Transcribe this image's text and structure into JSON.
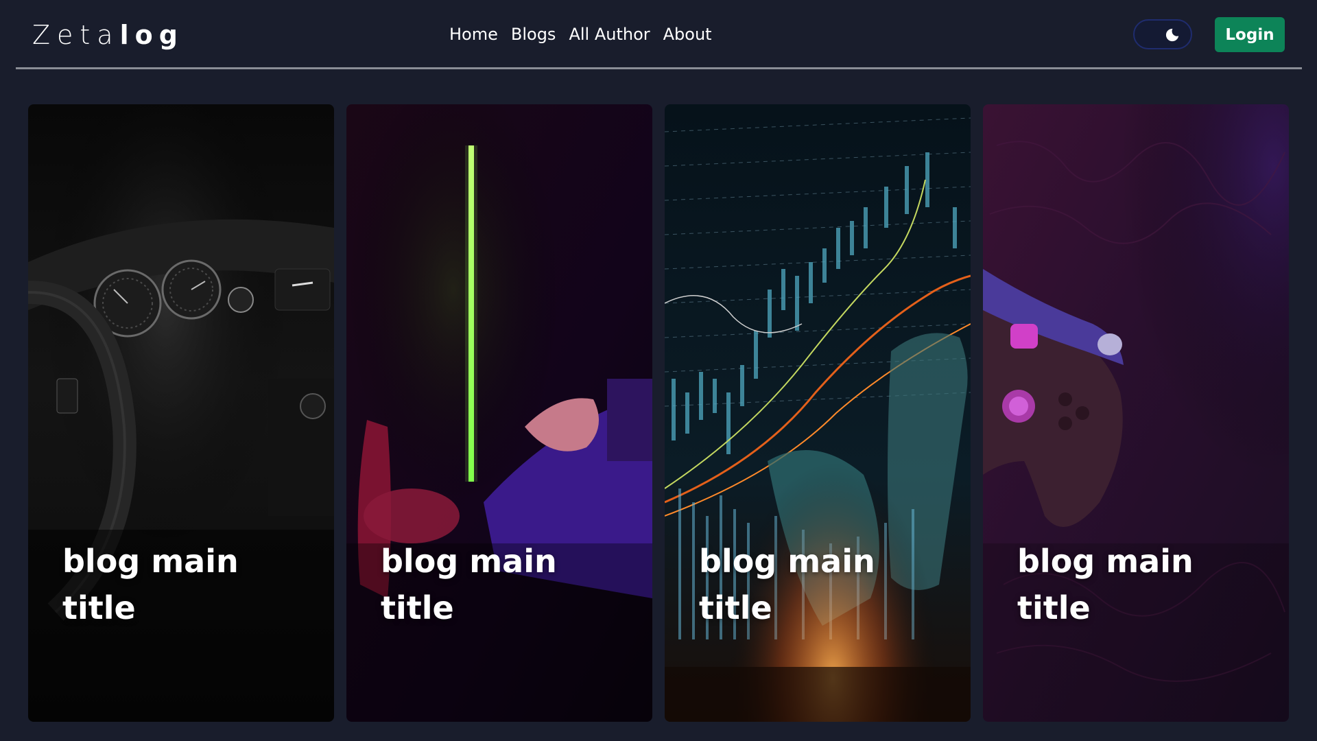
{
  "navbar": {
    "logo_light": "Zeta",
    "logo_bold": "log",
    "links": [
      {
        "label": "Home"
      },
      {
        "label": "Blogs"
      },
      {
        "label": "All Author"
      },
      {
        "label": "About"
      }
    ],
    "theme_toggle_icon": "moon-icon",
    "login_label": "Login",
    "colors": {
      "background": "#191d2c",
      "login_button": "#0d8458",
      "divider": "#8a8d96"
    }
  },
  "cards": [
    {
      "title": "blog main title",
      "image": "car-dashboard-image"
    },
    {
      "title": "blog main title",
      "image": "gamer-neon-room-image"
    },
    {
      "title": "blog main title",
      "image": "stock-chart-hand-image"
    },
    {
      "title": "blog main title",
      "image": "game-controller-image"
    }
  ]
}
